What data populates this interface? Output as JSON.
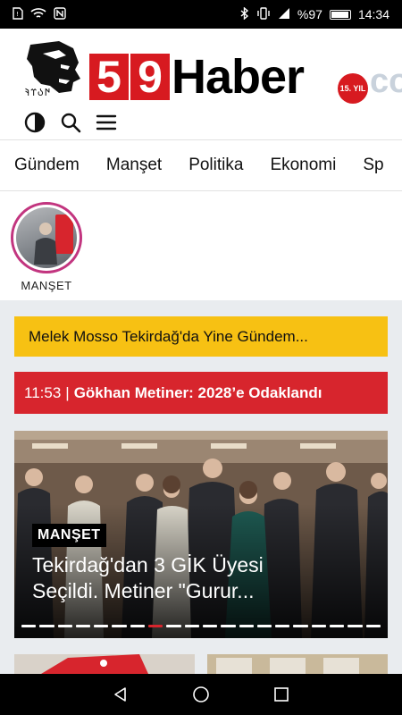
{
  "status": {
    "battery": "%97",
    "time": "14:34"
  },
  "site": {
    "logo_digits": [
      "5",
      "9"
    ],
    "logo_word": "Haber",
    "logo_badge": "15. YIL",
    "logo_suffix": "co",
    "logo_runes": "𐰇𐰉𐰼𐰚"
  },
  "nav": {
    "items": [
      "Gündem",
      "Manşet",
      "Politika",
      "Ekonomi",
      "Sp"
    ]
  },
  "stories": [
    {
      "label": "MANŞET"
    }
  ],
  "ticker": {
    "yellow": "Melek Mosso Tekirdağ'da Yine Gündem...",
    "time": "11:53",
    "separator": "|",
    "headline": "Gökhan Metiner: 2028’e Odaklandı"
  },
  "slider": {
    "category": "MANŞET",
    "title_line1": "Tekirdağ'dan 3 GİK Üyesi",
    "title_line2": "Seçildi. Metiner \"Gurur...",
    "dot_count": 20,
    "active_dot": 7
  },
  "colors": {
    "brand_red": "#d7252d",
    "ticker_yellow": "#f7c113",
    "story_ring": "#c2357f"
  }
}
